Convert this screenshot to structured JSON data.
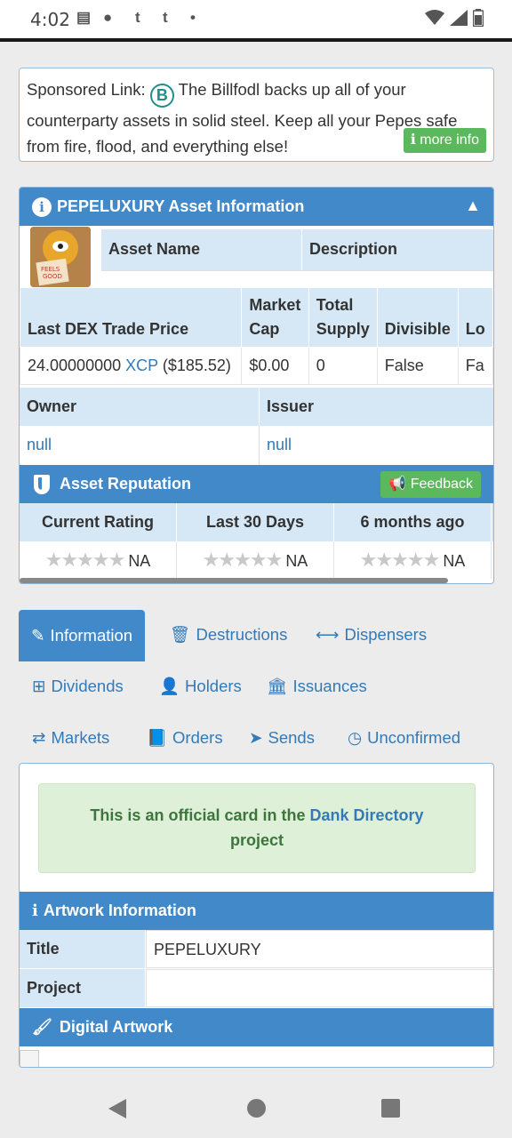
{
  "status_bar": {
    "time": "4:02",
    "notif_1": "▤",
    "notif_2": "●",
    "notif_3": "t",
    "notif_4": "t",
    "notif_5": "•"
  },
  "sponsor": {
    "prefix": "Sponsored Link:",
    "logo_letter": "B",
    "text": "The Billfodl backs up all of your counterparty assets in solid steel. Keep all your Pepes safe from fire, flood, and everything else!",
    "button": "more info"
  },
  "asset_panel": {
    "title": "PEPELUXURY Asset Information",
    "columns_top": [
      "Asset Name",
      "Description"
    ],
    "table_headers": [
      "Last DEX Trade Price",
      "Market Cap",
      "Total Supply",
      "Divisible",
      "Lo"
    ],
    "price_value": "24.00000000",
    "price_unit": "XCP",
    "price_usd": "($185.52)",
    "market_cap": "$0.00",
    "total_supply": "0",
    "divisible": "False",
    "locked": "Fa",
    "owner_label": "Owner",
    "issuer_label": "Issuer",
    "owner_value": "null",
    "issuer_value": "null"
  },
  "reputation": {
    "title": "Asset Reputation",
    "feedback_button": "Feedback",
    "headers": [
      "Current Rating",
      "Last 30 Days",
      "6 months ago"
    ],
    "values": [
      "NA",
      "NA",
      "NA"
    ],
    "stars": "★★★★★",
    "rating": 0
  },
  "tabs": {
    "information": "Information",
    "destructions": "Destructions",
    "dispensers": "Dispensers",
    "dividends": "Dividends",
    "holders": "Holders",
    "issuances": "Issuances",
    "markets": "Markets",
    "orders": "Orders",
    "sends": "Sends",
    "unconfirmed": "Unconfirmed"
  },
  "card": {
    "official_prefix": "This is an official card in the",
    "official_link": "Dank Directory",
    "official_suffix": "project",
    "artwork_title": "Artwork Information",
    "title_label": "Title",
    "title_value": "PEPELUXURY",
    "project_label": "Project",
    "project_value": "",
    "digital_artwork": "Digital Artwork"
  },
  "colors": {
    "primary": "#4289c9",
    "success": "#5cb85c",
    "link": "#337ab7",
    "header_bg": "#d6e8f6"
  }
}
